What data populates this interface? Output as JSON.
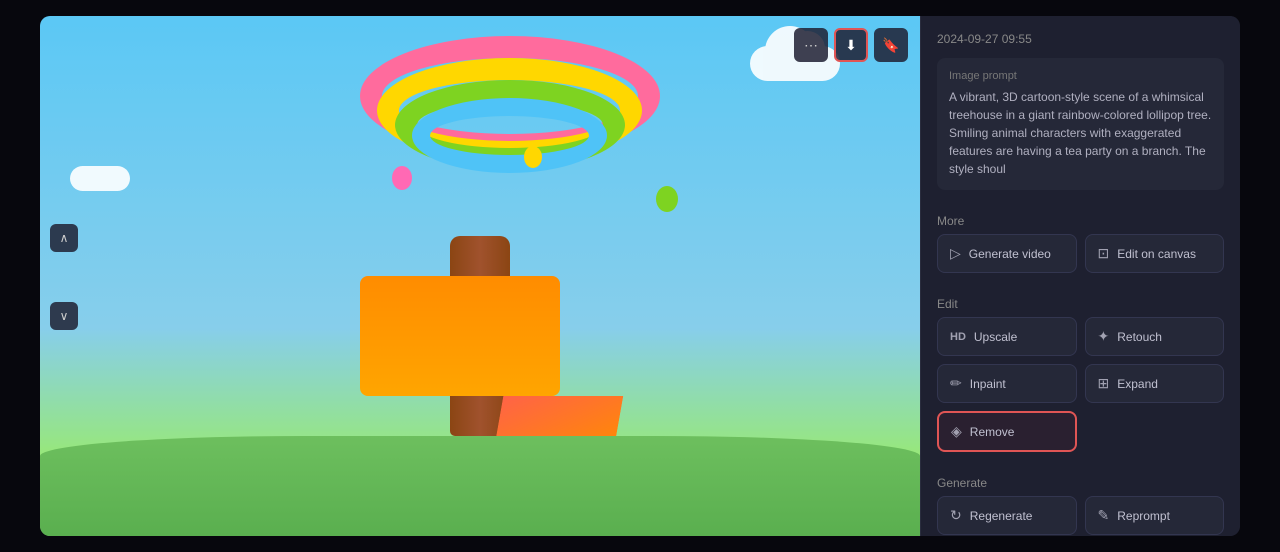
{
  "overlay": {
    "close_label": "×"
  },
  "toolbar": {
    "more_icon": "⋯",
    "download_icon": "⬇",
    "bookmark_icon": "🔖"
  },
  "nav": {
    "up_icon": "∧",
    "down_icon": "∨"
  },
  "right_panel": {
    "timestamp": "2024-09-27 09:55",
    "prompt_label": "Image prompt",
    "prompt_text": "A vibrant, 3D cartoon-style scene of a whimsical treehouse in a giant rainbow-colored lollipop tree. Smiling animal characters with exaggerated features are having a tea party on a branch. The style shoul",
    "more_label": "More",
    "edit_label": "Edit",
    "generate_label": "Generate",
    "actions": {
      "more": [
        {
          "id": "generate-video",
          "icon": "▷",
          "label": "Generate video"
        },
        {
          "id": "edit-on-canvas",
          "icon": "⊡",
          "label": "Edit on canvas"
        }
      ],
      "edit": [
        {
          "id": "upscale",
          "icon": "HD",
          "label": "Upscale",
          "icon_type": "text"
        },
        {
          "id": "retouch",
          "icon": "✦",
          "label": "Retouch"
        },
        {
          "id": "inpaint",
          "icon": "✏",
          "label": "Inpaint"
        },
        {
          "id": "expand",
          "icon": "⊞",
          "label": "Expand"
        },
        {
          "id": "remove",
          "icon": "◈",
          "label": "Remove",
          "highlighted": true
        }
      ],
      "generate": [
        {
          "id": "regenerate",
          "icon": "↻",
          "label": "Regenerate"
        },
        {
          "id": "reprompt",
          "icon": "✎",
          "label": "Reprompt"
        }
      ]
    }
  }
}
